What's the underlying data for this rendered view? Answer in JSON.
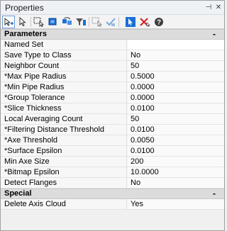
{
  "window": {
    "title": "Properties",
    "pin_glyph": "⊣",
    "close_glyph": "✕"
  },
  "toolbar": {
    "icons": [
      "add-point-icon",
      "select-arrow-icon",
      "select-rect-icon",
      "select-box-icon",
      "refresh-icon",
      "filter-icon",
      "deselect-rect-icon",
      "check-icon",
      "active-cursor-icon",
      "delete-icon",
      "help-icon"
    ]
  },
  "sections": [
    {
      "title": "Parameters",
      "collapse_glyph": "-",
      "rows": [
        {
          "name": "Named Set",
          "value": ""
        },
        {
          "name": "Save Type to Class",
          "value": "No"
        },
        {
          "name": "Neighbor Count",
          "value": "50"
        },
        {
          "name": "*Max Pipe Radius",
          "value": "0.5000"
        },
        {
          "name": "*Min Pipe Radius",
          "value": "0.0000"
        },
        {
          "name": "*Group Tolerance",
          "value": "0.0000"
        },
        {
          "name": "*Slice Thickness",
          "value": "0.0100"
        },
        {
          "name": "Local Averaging Count",
          "value": "50"
        },
        {
          "name": "*Filtering Distance Threshold",
          "value": "0.0100"
        },
        {
          "name": "*Axe Threshold",
          "value": "0.0050"
        },
        {
          "name": "*Surface Epsilon",
          "value": "0.0100"
        },
        {
          "name": "Min Axe Size",
          "value": "200"
        },
        {
          "name": "*Bitmap Epsilon",
          "value": "10.0000"
        },
        {
          "name": "Detect Flanges",
          "value": "No"
        }
      ]
    },
    {
      "title": "Special",
      "collapse_glyph": "-",
      "rows": [
        {
          "name": "Delete Axis Cloud",
          "value": "Yes"
        }
      ]
    }
  ]
}
